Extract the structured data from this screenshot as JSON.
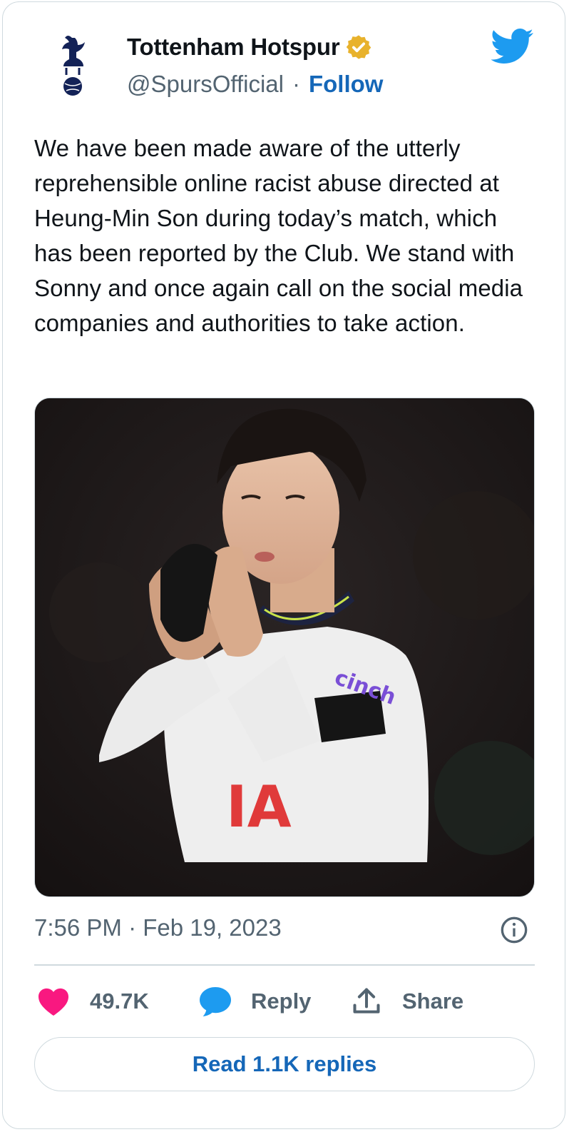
{
  "author": {
    "display_name": "Tottenham Hotspur",
    "handle": "@SpursOfficial",
    "separator": "·",
    "follow_label": "Follow",
    "verified_color": "#e8b22c"
  },
  "tweet": {
    "text": "We have been made aware of the utterly reprehensible online racist abuse directed at Heung-Min Son during today’s match, which has been reported by the Club. We stand with Sonny and once again call on the social media companies and authorities to take action.",
    "photo_sponsor_text": "cinch",
    "shirt_text": "IA",
    "timestamp": "7:56 PM · Feb 19, 2023"
  },
  "actions": {
    "like_count": "49.7K",
    "reply_label": "Reply",
    "share_label": "Share",
    "read_replies_label": "Read 1.1K replies"
  },
  "colors": {
    "brand_blue": "#1d9bf0",
    "link_blue": "#1567b8",
    "like_pink": "#f91880",
    "muted": "#536471",
    "border": "#cfd9de"
  }
}
